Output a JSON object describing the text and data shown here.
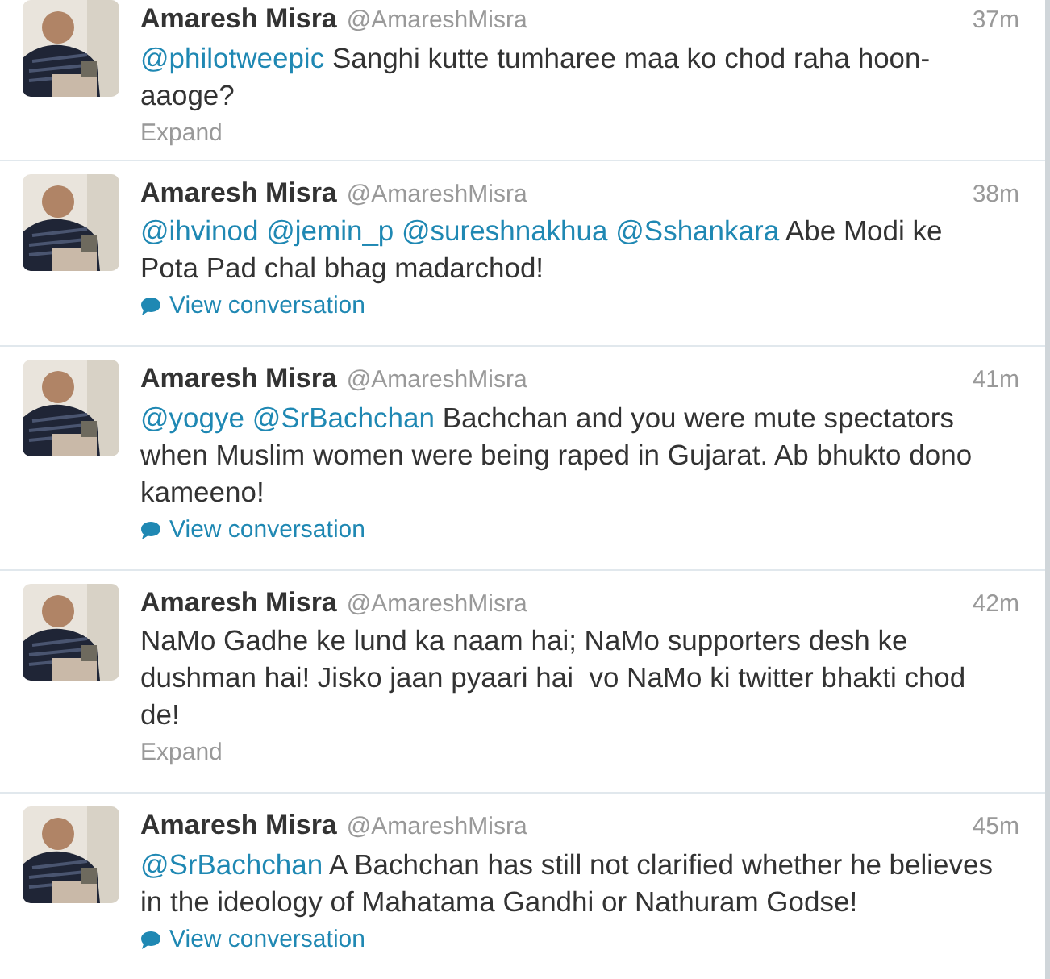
{
  "tweets": [
    {
      "name": "Amaresh Misra",
      "handle": "@AmareshMisra",
      "time": "37m",
      "segments": [
        {
          "kind": "mention",
          "text": "@philotweepic"
        },
        {
          "kind": "text",
          "text": " Sanghi kutte tumharee maa ko chod raha hoon-aaoge?"
        }
      ],
      "action": {
        "kind": "expand",
        "label": "Expand"
      }
    },
    {
      "name": "Amaresh Misra",
      "handle": "@AmareshMisra",
      "time": "38m",
      "segments": [
        {
          "kind": "mention",
          "text": "@ihvinod"
        },
        {
          "kind": "mention",
          "text": "@jemin_p"
        },
        {
          "kind": "mention",
          "text": "@sureshnakhua"
        },
        {
          "kind": "mention",
          "text": "@Sshankara"
        },
        {
          "kind": "text",
          "text": " Abe Modi ke Pota Pad chal bhag madarchod!"
        }
      ],
      "action": {
        "kind": "conversation",
        "label": "View conversation"
      }
    },
    {
      "name": "Amaresh Misra",
      "handle": "@AmareshMisra",
      "time": "41m",
      "segments": [
        {
          "kind": "mention",
          "text": "@yogye"
        },
        {
          "kind": "mention",
          "text": "@SrBachchan"
        },
        {
          "kind": "text",
          "text": " Bachchan and you were mute spectators when Muslim women were being raped in Gujarat. Ab bhukto dono kameeno!"
        }
      ],
      "action": {
        "kind": "conversation",
        "label": "View conversation"
      }
    },
    {
      "name": "Amaresh Misra",
      "handle": "@AmareshMisra",
      "time": "42m",
      "segments": [
        {
          "kind": "text",
          "text": "NaMo Gadhe ke lund ka naam hai; NaMo supporters desh ke dushman hai! Jisko jaan pyaari hai  vo NaMo ki twitter bhakti chod de!"
        }
      ],
      "action": {
        "kind": "expand",
        "label": "Expand"
      }
    },
    {
      "name": "Amaresh Misra",
      "handle": "@AmareshMisra",
      "time": "45m",
      "segments": [
        {
          "kind": "mention",
          "text": "@SrBachchan"
        },
        {
          "kind": "text",
          "text": " A Bachchan has still not clarified whether he believes in the ideology of Mahatama Gandhi or Nathuram Godse!"
        }
      ],
      "action": {
        "kind": "conversation",
        "label": "View conversation"
      }
    }
  ]
}
